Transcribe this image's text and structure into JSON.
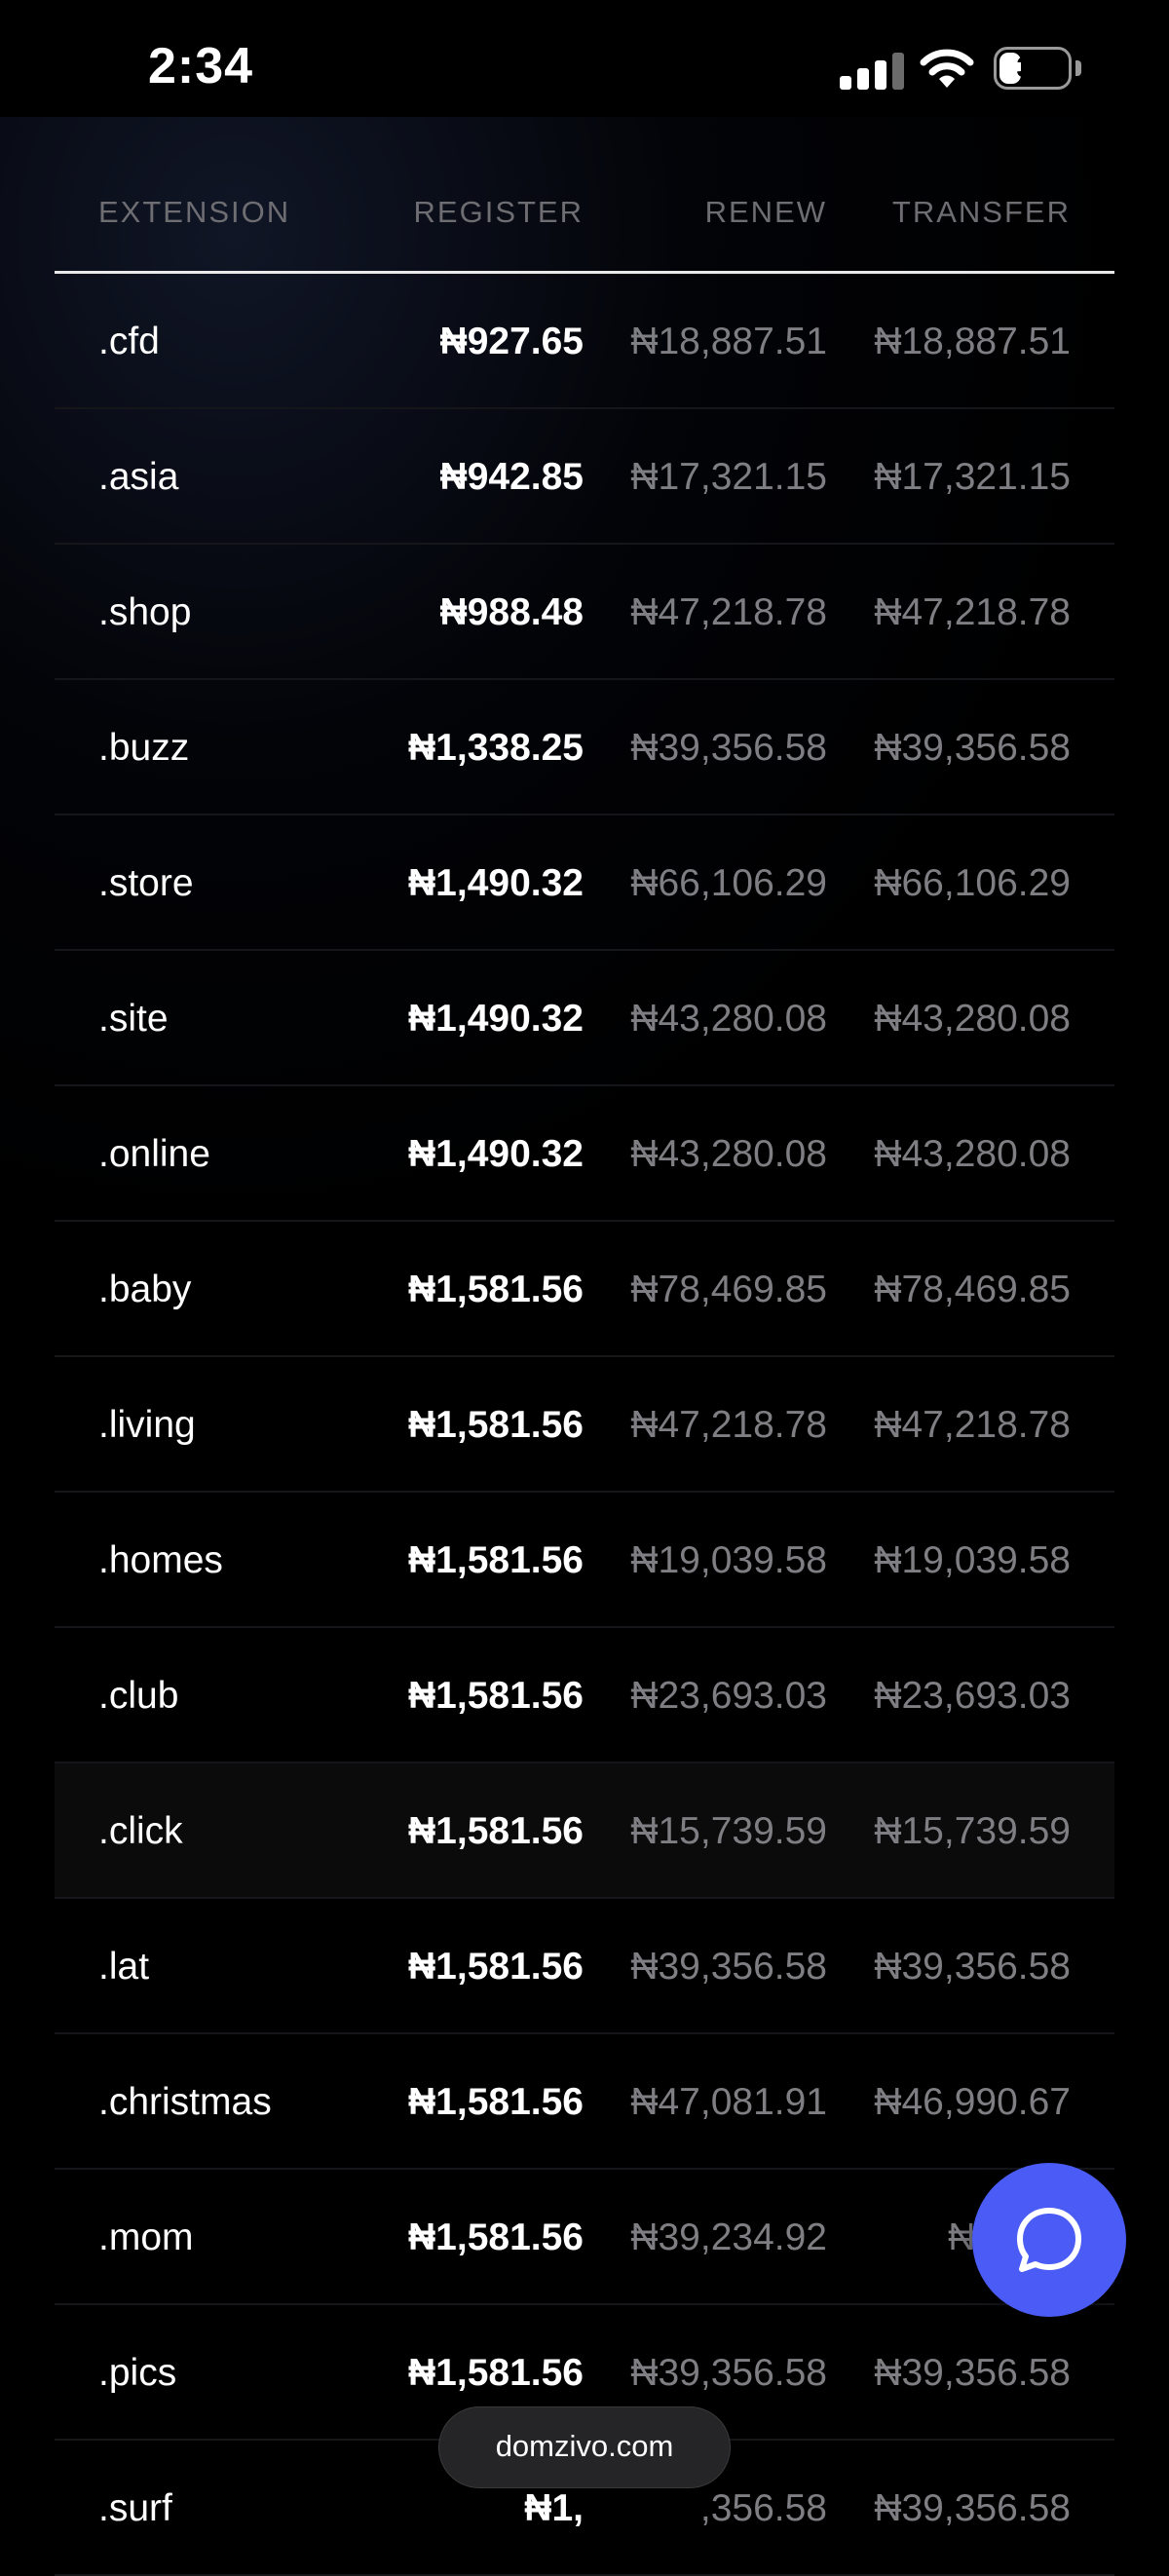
{
  "status_bar": {
    "time": "2:34",
    "battery": "30",
    "icons": [
      "signal-icon",
      "wifi-icon",
      "battery-icon"
    ]
  },
  "table": {
    "headers": {
      "extension": "EXTENSION",
      "register": "REGISTER",
      "renew": "RENEW",
      "transfer": "TRANSFER"
    },
    "rows": [
      {
        "ext": ".cfd",
        "register": "₦927.65",
        "renew": "₦18,887.51",
        "transfer": "₦18,887.51"
      },
      {
        "ext": ".asia",
        "register": "₦942.85",
        "renew": "₦17,321.15",
        "transfer": "₦17,321.15"
      },
      {
        "ext": ".shop",
        "register": "₦988.48",
        "renew": "₦47,218.78",
        "transfer": "₦47,218.78"
      },
      {
        "ext": ".buzz",
        "register": "₦1,338.25",
        "renew": "₦39,356.58",
        "transfer": "₦39,356.58"
      },
      {
        "ext": ".store",
        "register": "₦1,490.32",
        "renew": "₦66,106.29",
        "transfer": "₦66,106.29"
      },
      {
        "ext": ".site",
        "register": "₦1,490.32",
        "renew": "₦43,280.08",
        "transfer": "₦43,280.08"
      },
      {
        "ext": ".online",
        "register": "₦1,490.32",
        "renew": "₦43,280.08",
        "transfer": "₦43,280.08"
      },
      {
        "ext": ".baby",
        "register": "₦1,581.56",
        "renew": "₦78,469.85",
        "transfer": "₦78,469.85"
      },
      {
        "ext": ".living",
        "register": "₦1,581.56",
        "renew": "₦47,218.78",
        "transfer": "₦47,218.78"
      },
      {
        "ext": ".homes",
        "register": "₦1,581.56",
        "renew": "₦19,039.58",
        "transfer": "₦19,039.58"
      },
      {
        "ext": ".club",
        "register": "₦1,581.56",
        "renew": "₦23,693.03",
        "transfer": "₦23,693.03"
      },
      {
        "ext": ".click",
        "register": "₦1,581.56",
        "renew": "₦15,739.59",
        "transfer": "₦15,739.59"
      },
      {
        "ext": ".lat",
        "register": "₦1,581.56",
        "renew": "₦39,356.58",
        "transfer": "₦39,356.58"
      },
      {
        "ext": ".christmas",
        "register": "₦1,581.56",
        "renew": "₦47,081.91",
        "transfer": "₦46,990.67"
      },
      {
        "ext": ".mom",
        "register": "₦1,581.56",
        "renew": "₦39,234.92",
        "transfer": "₦39,23"
      },
      {
        "ext": ".pics",
        "register": "₦1,581.56",
        "renew": "₦39,356.58",
        "transfer": "₦39,356.58"
      },
      {
        "ext": ".surf",
        "register": "₦1,",
        "renew": ",356.58",
        "transfer": "₦39,356.58"
      }
    ],
    "highlighted_row": 11
  },
  "chat_button": {
    "icon": "chat-bubble-icon",
    "color": "#4a5cf5"
  },
  "browser": {
    "url": "domzivo.com"
  }
}
